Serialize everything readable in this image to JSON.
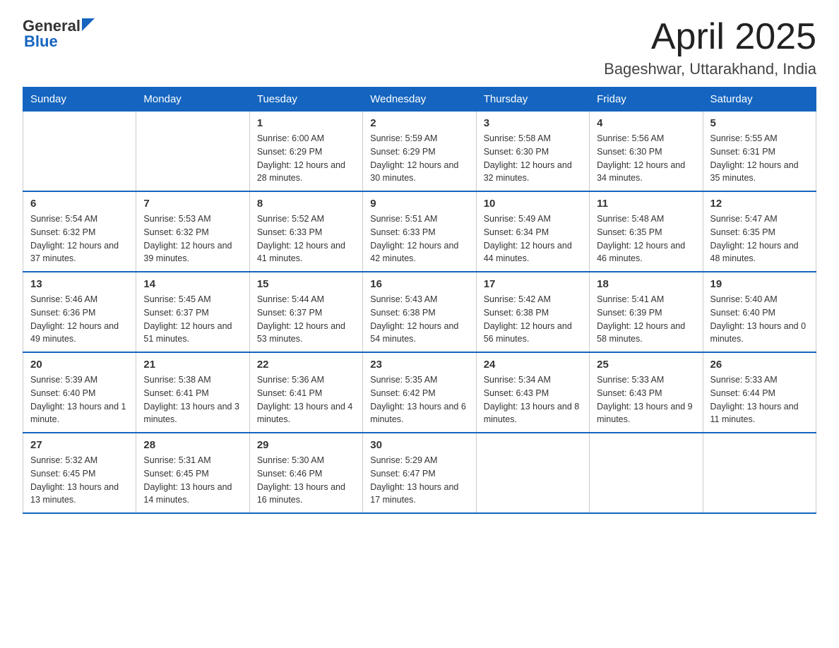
{
  "logo": {
    "general": "General",
    "blue": "Blue"
  },
  "header": {
    "month_year": "April 2025",
    "location": "Bageshwar, Uttarakhand, India"
  },
  "weekdays": [
    "Sunday",
    "Monday",
    "Tuesday",
    "Wednesday",
    "Thursday",
    "Friday",
    "Saturday"
  ],
  "weeks": [
    [
      {
        "day": "",
        "sunrise": "",
        "sunset": "",
        "daylight": ""
      },
      {
        "day": "",
        "sunrise": "",
        "sunset": "",
        "daylight": ""
      },
      {
        "day": "1",
        "sunrise": "Sunrise: 6:00 AM",
        "sunset": "Sunset: 6:29 PM",
        "daylight": "Daylight: 12 hours and 28 minutes."
      },
      {
        "day": "2",
        "sunrise": "Sunrise: 5:59 AM",
        "sunset": "Sunset: 6:29 PM",
        "daylight": "Daylight: 12 hours and 30 minutes."
      },
      {
        "day": "3",
        "sunrise": "Sunrise: 5:58 AM",
        "sunset": "Sunset: 6:30 PM",
        "daylight": "Daylight: 12 hours and 32 minutes."
      },
      {
        "day": "4",
        "sunrise": "Sunrise: 5:56 AM",
        "sunset": "Sunset: 6:30 PM",
        "daylight": "Daylight: 12 hours and 34 minutes."
      },
      {
        "day": "5",
        "sunrise": "Sunrise: 5:55 AM",
        "sunset": "Sunset: 6:31 PM",
        "daylight": "Daylight: 12 hours and 35 minutes."
      }
    ],
    [
      {
        "day": "6",
        "sunrise": "Sunrise: 5:54 AM",
        "sunset": "Sunset: 6:32 PM",
        "daylight": "Daylight: 12 hours and 37 minutes."
      },
      {
        "day": "7",
        "sunrise": "Sunrise: 5:53 AM",
        "sunset": "Sunset: 6:32 PM",
        "daylight": "Daylight: 12 hours and 39 minutes."
      },
      {
        "day": "8",
        "sunrise": "Sunrise: 5:52 AM",
        "sunset": "Sunset: 6:33 PM",
        "daylight": "Daylight: 12 hours and 41 minutes."
      },
      {
        "day": "9",
        "sunrise": "Sunrise: 5:51 AM",
        "sunset": "Sunset: 6:33 PM",
        "daylight": "Daylight: 12 hours and 42 minutes."
      },
      {
        "day": "10",
        "sunrise": "Sunrise: 5:49 AM",
        "sunset": "Sunset: 6:34 PM",
        "daylight": "Daylight: 12 hours and 44 minutes."
      },
      {
        "day": "11",
        "sunrise": "Sunrise: 5:48 AM",
        "sunset": "Sunset: 6:35 PM",
        "daylight": "Daylight: 12 hours and 46 minutes."
      },
      {
        "day": "12",
        "sunrise": "Sunrise: 5:47 AM",
        "sunset": "Sunset: 6:35 PM",
        "daylight": "Daylight: 12 hours and 48 minutes."
      }
    ],
    [
      {
        "day": "13",
        "sunrise": "Sunrise: 5:46 AM",
        "sunset": "Sunset: 6:36 PM",
        "daylight": "Daylight: 12 hours and 49 minutes."
      },
      {
        "day": "14",
        "sunrise": "Sunrise: 5:45 AM",
        "sunset": "Sunset: 6:37 PM",
        "daylight": "Daylight: 12 hours and 51 minutes."
      },
      {
        "day": "15",
        "sunrise": "Sunrise: 5:44 AM",
        "sunset": "Sunset: 6:37 PM",
        "daylight": "Daylight: 12 hours and 53 minutes."
      },
      {
        "day": "16",
        "sunrise": "Sunrise: 5:43 AM",
        "sunset": "Sunset: 6:38 PM",
        "daylight": "Daylight: 12 hours and 54 minutes."
      },
      {
        "day": "17",
        "sunrise": "Sunrise: 5:42 AM",
        "sunset": "Sunset: 6:38 PM",
        "daylight": "Daylight: 12 hours and 56 minutes."
      },
      {
        "day": "18",
        "sunrise": "Sunrise: 5:41 AM",
        "sunset": "Sunset: 6:39 PM",
        "daylight": "Daylight: 12 hours and 58 minutes."
      },
      {
        "day": "19",
        "sunrise": "Sunrise: 5:40 AM",
        "sunset": "Sunset: 6:40 PM",
        "daylight": "Daylight: 13 hours and 0 minutes."
      }
    ],
    [
      {
        "day": "20",
        "sunrise": "Sunrise: 5:39 AM",
        "sunset": "Sunset: 6:40 PM",
        "daylight": "Daylight: 13 hours and 1 minute."
      },
      {
        "day": "21",
        "sunrise": "Sunrise: 5:38 AM",
        "sunset": "Sunset: 6:41 PM",
        "daylight": "Daylight: 13 hours and 3 minutes."
      },
      {
        "day": "22",
        "sunrise": "Sunrise: 5:36 AM",
        "sunset": "Sunset: 6:41 PM",
        "daylight": "Daylight: 13 hours and 4 minutes."
      },
      {
        "day": "23",
        "sunrise": "Sunrise: 5:35 AM",
        "sunset": "Sunset: 6:42 PM",
        "daylight": "Daylight: 13 hours and 6 minutes."
      },
      {
        "day": "24",
        "sunrise": "Sunrise: 5:34 AM",
        "sunset": "Sunset: 6:43 PM",
        "daylight": "Daylight: 13 hours and 8 minutes."
      },
      {
        "day": "25",
        "sunrise": "Sunrise: 5:33 AM",
        "sunset": "Sunset: 6:43 PM",
        "daylight": "Daylight: 13 hours and 9 minutes."
      },
      {
        "day": "26",
        "sunrise": "Sunrise: 5:33 AM",
        "sunset": "Sunset: 6:44 PM",
        "daylight": "Daylight: 13 hours and 11 minutes."
      }
    ],
    [
      {
        "day": "27",
        "sunrise": "Sunrise: 5:32 AM",
        "sunset": "Sunset: 6:45 PM",
        "daylight": "Daylight: 13 hours and 13 minutes."
      },
      {
        "day": "28",
        "sunrise": "Sunrise: 5:31 AM",
        "sunset": "Sunset: 6:45 PM",
        "daylight": "Daylight: 13 hours and 14 minutes."
      },
      {
        "day": "29",
        "sunrise": "Sunrise: 5:30 AM",
        "sunset": "Sunset: 6:46 PM",
        "daylight": "Daylight: 13 hours and 16 minutes."
      },
      {
        "day": "30",
        "sunrise": "Sunrise: 5:29 AM",
        "sunset": "Sunset: 6:47 PM",
        "daylight": "Daylight: 13 hours and 17 minutes."
      },
      {
        "day": "",
        "sunrise": "",
        "sunset": "",
        "daylight": ""
      },
      {
        "day": "",
        "sunrise": "",
        "sunset": "",
        "daylight": ""
      },
      {
        "day": "",
        "sunrise": "",
        "sunset": "",
        "daylight": ""
      }
    ]
  ]
}
